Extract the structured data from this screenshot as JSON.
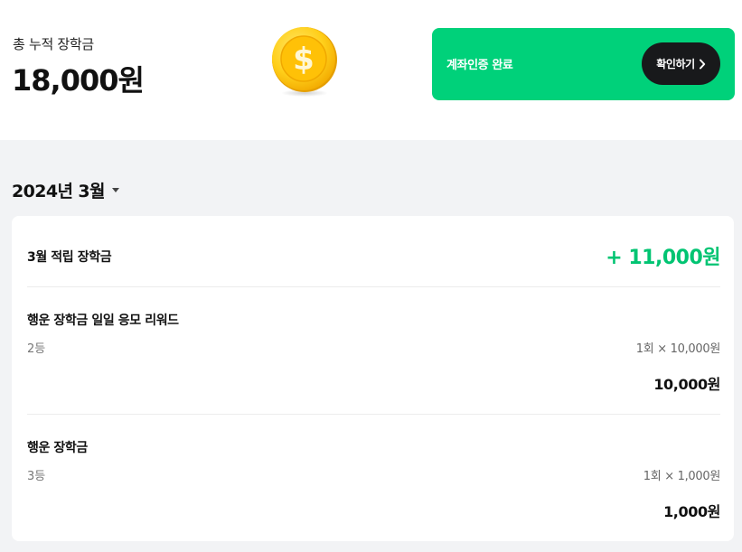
{
  "summary": {
    "total_label": "총 누적 장학금",
    "total_amount": "18,000원"
  },
  "banner": {
    "text": "계좌인증 완료",
    "button_label": "확인하기",
    "color": "#00d17a"
  },
  "month_selector": {
    "label": "2024년 3월"
  },
  "month_summary": {
    "label": "3월 적립 장학금",
    "value": "+ 11,000원",
    "accent": "#00c472"
  },
  "rewards": [
    {
      "title": "행운 장학금 일일 응모 리워드",
      "rank": "2등",
      "calc": "1회 × 10,000원",
      "total": "10,000원"
    },
    {
      "title": "행운 장학금",
      "rank": "3등",
      "calc": "1회 × 1,000원",
      "total": "1,000원"
    }
  ],
  "icons": {
    "coin": "dollar-coin-icon",
    "chevron": "chevron-right-icon",
    "caret": "caret-down-icon"
  }
}
